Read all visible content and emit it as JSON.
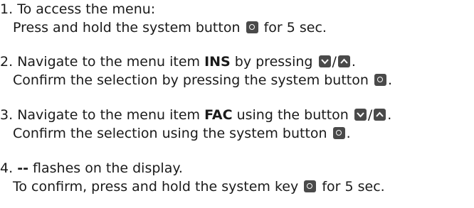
{
  "steps": [
    {
      "number": "1.",
      "line1": "To access the menu:",
      "line2_a": "Press and hold the system button",
      "line2_b": "for 5 sec."
    },
    {
      "number": "2.",
      "line1_a": "Navigate to the menu item",
      "line1_bold": "INS",
      "line1_b": "by pressing",
      "line1_sep": "/",
      "line1_end": ".",
      "line2_a": "Confirm the selection by pressing the system button",
      "line2_end": "."
    },
    {
      "number": "3.",
      "line1_a": "Navigate to the menu item",
      "line1_bold": "FAC",
      "line1_b": "using the button",
      "line1_sep": "/",
      "line1_end": ".",
      "line2_a": "Confirm the selection using the system button",
      "line2_end": "."
    },
    {
      "number": "4.",
      "line1_bold": "--",
      "line1_b": "flashes on the display.",
      "line2_a": "To confirm, press and hold the system key",
      "line2_b": "for 5 sec."
    }
  ],
  "icons": {
    "system": "system-button-icon",
    "down": "arrow-down-button-icon",
    "up": "arrow-up-button-icon"
  },
  "colors": {
    "key_bg": "#4a4a4a",
    "text": "#1a1a1a"
  }
}
